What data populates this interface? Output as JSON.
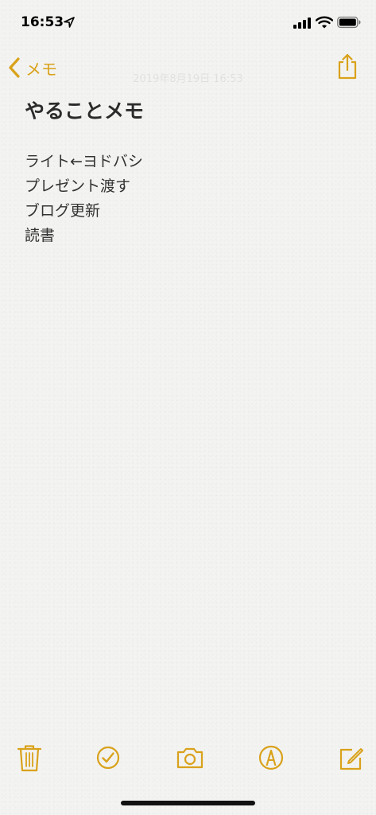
{
  "status_bar": {
    "time": "16:53",
    "icons": [
      "location-arrow-icon",
      "cellular-signal-icon",
      "wifi-icon",
      "battery-icon"
    ]
  },
  "nav": {
    "back_label": "メモ",
    "faded_date": "2019年8月19日 16:53"
  },
  "note": {
    "title": "やることメモ",
    "lines": [
      "ライト←ヨドバシ",
      "プレゼント渡す",
      "ブログ更新",
      "読書"
    ]
  },
  "toolbar": {
    "icons": [
      "trash-icon",
      "checklist-icon",
      "camera-icon",
      "markup-icon",
      "compose-icon"
    ]
  },
  "colors": {
    "accent": "#d9a21b",
    "background": "#f3f3f1",
    "text": "#2b2b2b"
  }
}
